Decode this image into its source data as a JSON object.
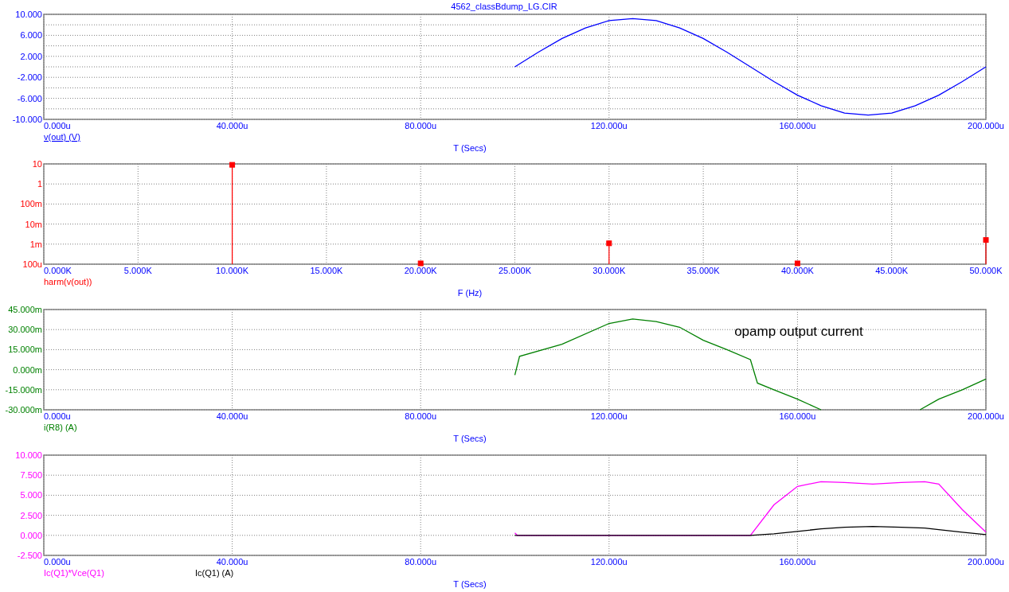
{
  "panels": [
    {
      "active": true,
      "minor_grid": true,
      "chart_data": {
        "type": "line",
        "grid": true,
        "title": "4562_classBdump_LG.CIR",
        "xlabel": "T (Secs)",
        "x": [
          100,
          105,
          110,
          115,
          120,
          125,
          130,
          135,
          140,
          145,
          150,
          155,
          160,
          165,
          170,
          175,
          180,
          185,
          190,
          195,
          200
        ],
        "series": [
          {
            "name": "v(out) (V)",
            "color": "#0000ff",
            "values": [
              0,
              2.8,
              5.4,
              7.4,
              8.8,
              9.2,
              8.8,
              7.4,
              5.4,
              2.8,
              0,
              -2.8,
              -5.4,
              -7.4,
              -8.8,
              -9.2,
              -8.8,
              -7.4,
              -5.4,
              -2.8,
              0
            ]
          }
        ],
        "xlim": [
          0,
          200
        ],
        "ylim": [
          -10,
          10
        ],
        "xticks": [
          {
            "value": 0,
            "label": "0.000u"
          },
          {
            "value": 40,
            "label": "40.000u"
          },
          {
            "value": 80,
            "label": "80.000u"
          },
          {
            "value": 120,
            "label": "120.000u"
          },
          {
            "value": 160,
            "label": "160.000u"
          },
          {
            "value": 200,
            "label": "200.000u"
          }
        ],
        "yticks": [
          {
            "value": 10,
            "label": "10.000"
          },
          {
            "value": 6,
            "label": "6.000"
          },
          {
            "value": 2,
            "label": "2.000"
          },
          {
            "value": -2,
            "label": "-2.000"
          },
          {
            "value": -6,
            "label": "-6.000"
          },
          {
            "value": -10,
            "label": "-10.000"
          }
        ]
      }
    },
    {
      "kind": "spectrum",
      "xlabel": "F (Hz)",
      "legend": [
        {
          "name": "harm(v(out))",
          "color": "#ff0000"
        }
      ],
      "x_tick_labels": [
        "0.000K",
        "5.000K",
        "10.000K",
        "15.000K",
        "20.000K",
        "25.000K",
        "30.000K",
        "35.000K",
        "40.000K",
        "45.000K",
        "50.000K"
      ],
      "y_tick_labels": [
        "10",
        "1",
        "100m",
        "10m",
        "1m",
        "100u"
      ]
    },
    {
      "chart_data": {
        "type": "line",
        "grid": true,
        "xlabel": "T (Secs)",
        "x": [
          100,
          101,
          110,
          120,
          125,
          130,
          135,
          140,
          145,
          150,
          151.5,
          155,
          160,
          165,
          175,
          186,
          190,
          195,
          200
        ],
        "series": [
          {
            "name": "i(R8) (A)",
            "color": "#008000",
            "values": [
              -4,
              10,
              19,
              34.6,
              38,
              36,
              31.7,
              22,
              15,
              7.5,
              -10,
              -15,
              -22,
              -30,
              null,
              -30,
              -22,
              -15,
              -7
            ]
          }
        ],
        "xlim": [
          0,
          200
        ],
        "ylim": [
          -30,
          45
        ],
        "xticks": [
          {
            "value": 0,
            "label": "0.000u"
          },
          {
            "value": 40,
            "label": "40.000u"
          },
          {
            "value": 80,
            "label": "80.000u"
          },
          {
            "value": 120,
            "label": "120.000u"
          },
          {
            "value": 160,
            "label": "160.000u"
          },
          {
            "value": 200,
            "label": "200.000u"
          }
        ],
        "yticks": [
          {
            "value": 45,
            "label": "45.000m"
          },
          {
            "value": 30,
            "label": "30.000m"
          },
          {
            "value": 15,
            "label": "15.000m"
          },
          {
            "value": 0,
            "label": "0.000m"
          },
          {
            "value": -15,
            "label": "-15.000m"
          },
          {
            "value": -30,
            "label": "-30.000m"
          }
        ],
        "annotations": [
          "opamp output current"
        ]
      }
    },
    {
      "chart_data": {
        "type": "line",
        "grid": true,
        "xlabel": "T (Secs)",
        "x": [
          100,
          100.5,
          150,
          155,
          160,
          165,
          170,
          176,
          182,
          187,
          190,
          195,
          200
        ],
        "series": [
          {
            "name": "Ic(Q1)*Vce(Q1)",
            "color": "#ff00ff",
            "values": [
              0.3,
              0,
              0,
              3.8,
              6.1,
              6.7,
              6.6,
              6.4,
              6.6,
              6.7,
              6.4,
              3.2,
              0.4
            ]
          },
          {
            "name": "Ic(Q1) (A)",
            "color": "#000000",
            "values": [
              0,
              0,
              0,
              0.2,
              0.5,
              0.8,
              1.0,
              1.1,
              1.0,
              0.9,
              0.7,
              0.4,
              0.1
            ]
          }
        ],
        "xlim": [
          0,
          200
        ],
        "ylim": [
          -2.5,
          10
        ],
        "xticks": [
          {
            "value": 0,
            "label": "0.000u"
          },
          {
            "value": 40,
            "label": "40.000u"
          },
          {
            "value": 80,
            "label": "80.000u"
          },
          {
            "value": 120,
            "label": "120.000u"
          },
          {
            "value": 160,
            "label": "160.000u"
          },
          {
            "value": 200,
            "label": "200.000u"
          }
        ],
        "yticks": [
          {
            "value": 10,
            "label": "10.000"
          },
          {
            "value": 7.5,
            "label": "7.500"
          },
          {
            "value": 5,
            "label": "5.000"
          },
          {
            "value": 2.5,
            "label": "2.500"
          },
          {
            "value": 0,
            "label": "0.000"
          },
          {
            "value": -2.5,
            "label": "-2.500"
          }
        ]
      }
    }
  ]
}
